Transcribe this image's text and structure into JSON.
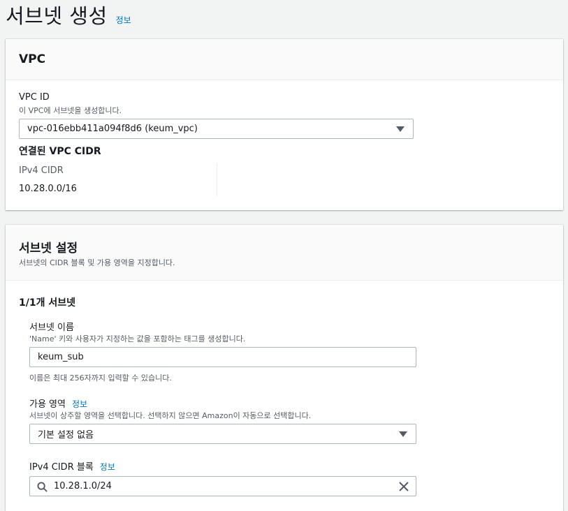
{
  "page": {
    "title": "서브넷 생성",
    "info_link": "정보"
  },
  "vpc_panel": {
    "heading": "VPC",
    "vpc_id_label": "VPC ID",
    "vpc_id_desc": "이 VPC에 서브넷을 생성합니다.",
    "vpc_id_value": "vpc-016ebb411a094f8d6 (keum_vpc)",
    "cidr_heading": "연결된 VPC CIDR",
    "ipv4_label": "IPv4 CIDR",
    "ipv4_value": "10.28.0.0/16"
  },
  "subnet_panel": {
    "heading": "서브넷 설정",
    "desc": "서브넷의 CIDR 블록 및 가용 영역을 지정합니다.",
    "count_title": "1/1개 서브넷",
    "name_label": "서브넷 이름",
    "name_desc": "'Name' 키와 사용자가 지정하는 값을 포함하는 태그를 생성합니다.",
    "name_value": "keum_sub",
    "name_hint": "이름은 최대 256자까지 입력할 수 있습니다.",
    "az_label": "가용 영역",
    "az_info": "정보",
    "az_desc": "서브넷이 상주할 영역을 선택합니다. 선택하지 않으면 Amazon이 자동으로 선택합니다.",
    "az_value": "기본 설정 없음",
    "cidr_label": "IPv4 CIDR 블록",
    "cidr_info": "정보",
    "cidr_value": "10.28.1.0/24"
  },
  "icons": {
    "dropdown": "caret-down-icon",
    "search": "search-icon",
    "clear": "close-icon"
  },
  "colors": {
    "link": "#0073bb",
    "background": "#f2f3f3",
    "border": "#aab7b8"
  }
}
